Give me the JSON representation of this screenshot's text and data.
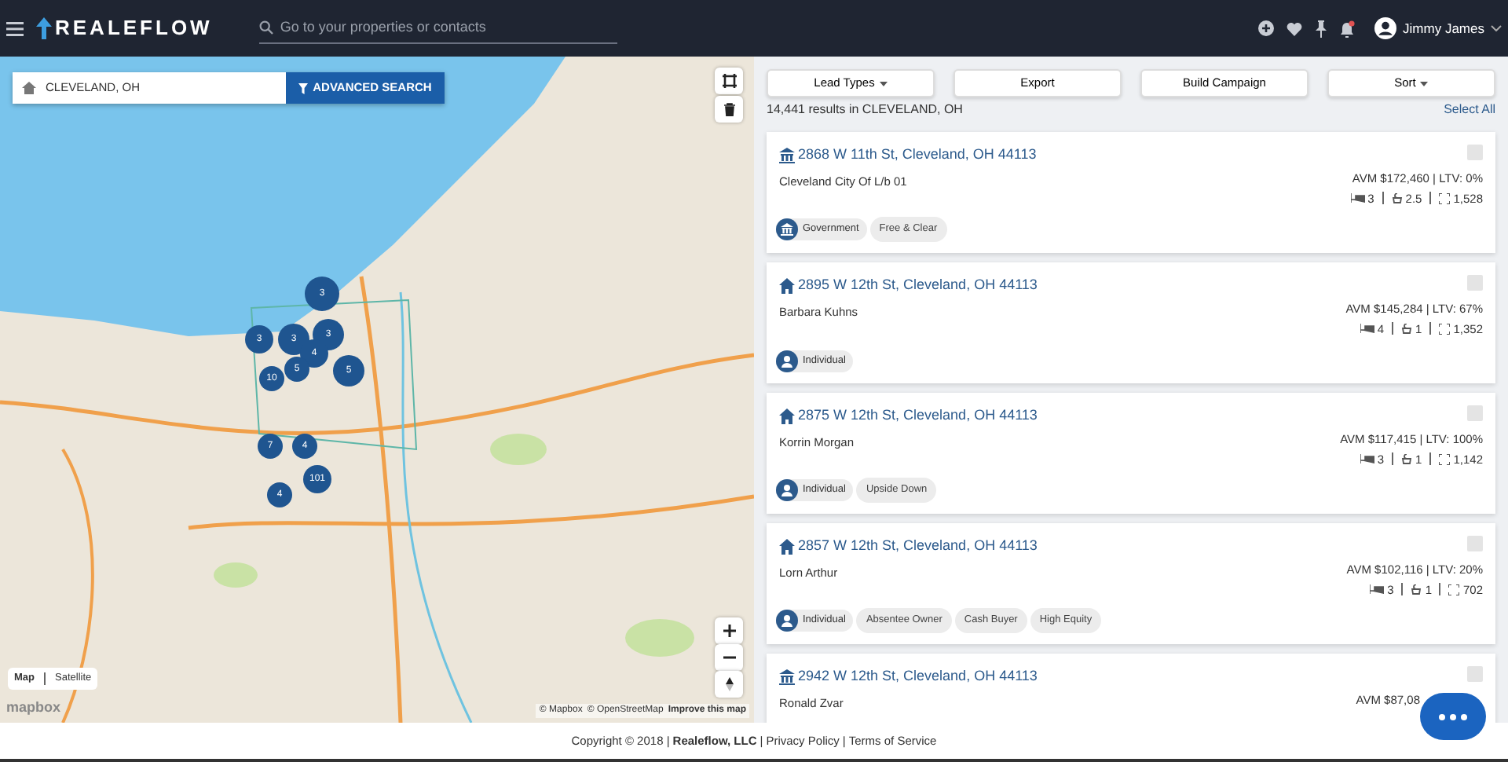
{
  "header": {
    "brand": "REALEFLOW",
    "search_placeholder": "Go to your properties or contacts",
    "notifications_unread": true,
    "user": "Jimmy James"
  },
  "map": {
    "search_value": "CLEVELAND, OH",
    "advanced_search": "ADVANCED SEARCH",
    "clusters": [
      "3",
      "3",
      "3",
      "3",
      "4",
      "5",
      "10",
      "5",
      "7",
      "4",
      "101",
      "4"
    ],
    "toggle": [
      {
        "label": "Map",
        "selected": true
      },
      {
        "label": "Satellite",
        "selected": false
      }
    ],
    "logo": "mapbox",
    "attribution": [
      "© Mapbox",
      "© OpenStreetMap",
      "Improve this map"
    ]
  },
  "toolbar": [
    {
      "label": "Lead Types",
      "dropdown": true
    },
    {
      "label": "Export",
      "dropdown": false
    },
    {
      "label": "Build Campaign",
      "dropdown": false
    },
    {
      "label": "Sort",
      "dropdown": true
    }
  ],
  "results": "14,441 results in CLEVELAND, OH",
  "select_all": "Select All",
  "listings": [
    {
      "address": "2868 W 11th St, Cleveland, OH 44113",
      "owner": "Cleveland City Of L/b 01",
      "avm": "AVM $172,460 | LTV: 0%",
      "beds": "3",
      "baths": "2.5",
      "sqft": "1,528",
      "kind": "government",
      "checked": false,
      "tags": [
        "Government",
        "Free & Clear"
      ]
    },
    {
      "address": "2895 W 12th St, Cleveland, OH 44113",
      "owner": "Barbara Kuhns",
      "avm": "AVM $145,284 | LTV: 67%",
      "beds": "4",
      "baths": "1",
      "sqft": "1,352",
      "kind": "individual",
      "checked": false,
      "tags": [
        "Individual"
      ]
    },
    {
      "address": "2875 W 12th St, Cleveland, OH 44113",
      "owner": "Korrin Morgan",
      "avm": "AVM $117,415 | LTV: 100%",
      "beds": "3",
      "baths": "1",
      "sqft": "1,142",
      "kind": "individual",
      "checked": false,
      "tags": [
        "Individual",
        "Upside Down"
      ]
    },
    {
      "address": "2857 W 12th St, Cleveland, OH 44113",
      "owner": "Lorn Arthur",
      "avm": "AVM $102,116 | LTV: 20%",
      "beds": "3",
      "baths": "1",
      "sqft": "702",
      "kind": "individual",
      "checked": false,
      "tags": [
        "Individual",
        "Absentee Owner",
        "Cash Buyer",
        "High Equity"
      ]
    },
    {
      "address": "2942 W 12th St, Cleveland, OH 44113",
      "owner": "Ronald Zvar",
      "avm": "AVM $87,08",
      "kind": "government",
      "checked": false
    }
  ],
  "footer": [
    {
      "kind": "text",
      "text": "Copyright © 2018 |"
    },
    {
      "kind": "strong",
      "text": "Realeflow, LLC"
    },
    {
      "kind": "text",
      "text": "|"
    },
    {
      "kind": "link",
      "text": "Privacy Policy"
    },
    {
      "kind": "text",
      "text": "|"
    },
    {
      "kind": "link",
      "text": "Terms of Service"
    }
  ]
}
